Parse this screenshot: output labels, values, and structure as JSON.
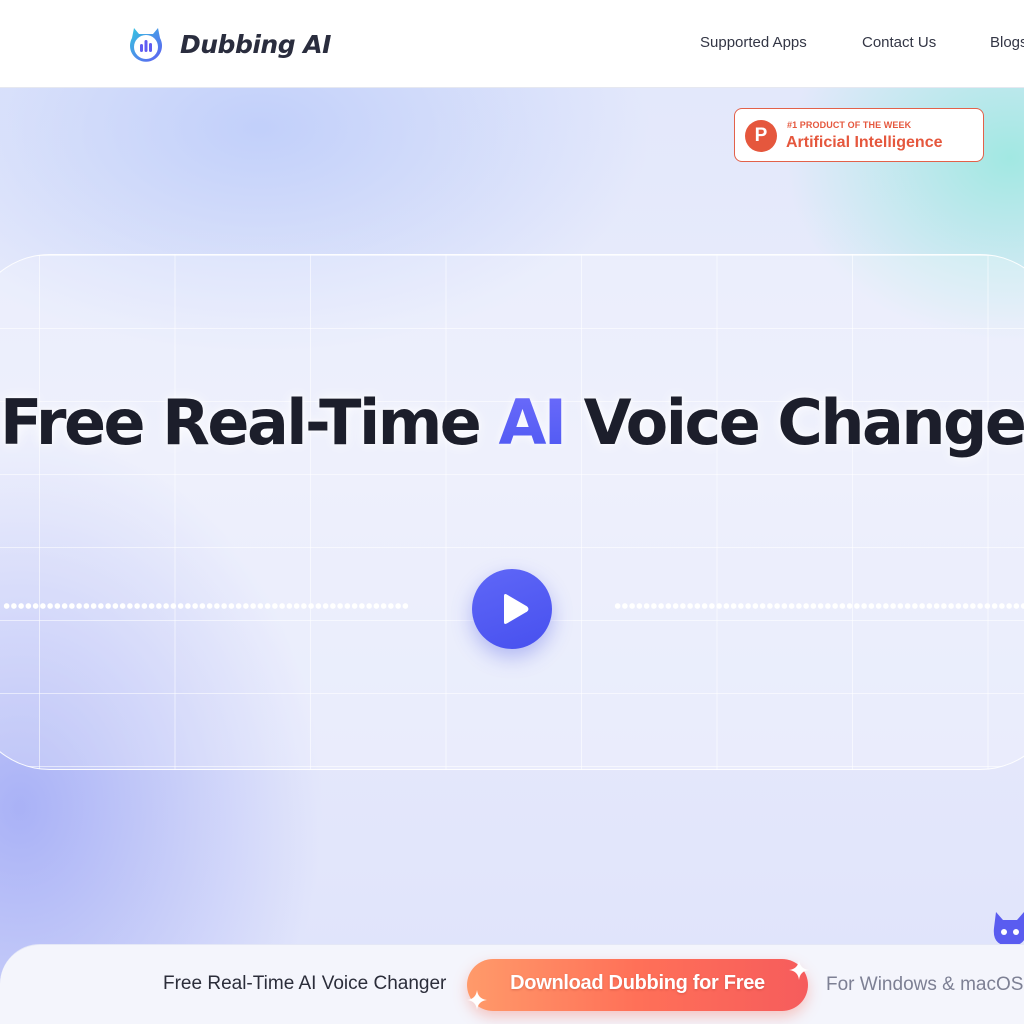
{
  "header": {
    "brand": "Dubbing AI",
    "logo_icon": "dubbing-ai-logo-icon",
    "nav": [
      {
        "label": "Supported Apps"
      },
      {
        "label": "Contact Us"
      },
      {
        "label": "Blogs"
      }
    ]
  },
  "badge": {
    "icon": "product-hunt-icon",
    "letter": "P",
    "small_text": "#1 PRODUCT OF THE WEEK",
    "big_text": "Artificial Intelligence",
    "color": "#e5573d"
  },
  "hero": {
    "headline_before": "Free Real-Time ",
    "headline_accent": "AI",
    "headline_after": " Voice Changer",
    "accent_color": "#5560f5",
    "play_icon": "play-icon"
  },
  "cta": {
    "title": "Free Real-Time AI Voice Changer",
    "button_label": "Download Dubbing for Free",
    "platform_note": "For Windows & macOS"
  }
}
